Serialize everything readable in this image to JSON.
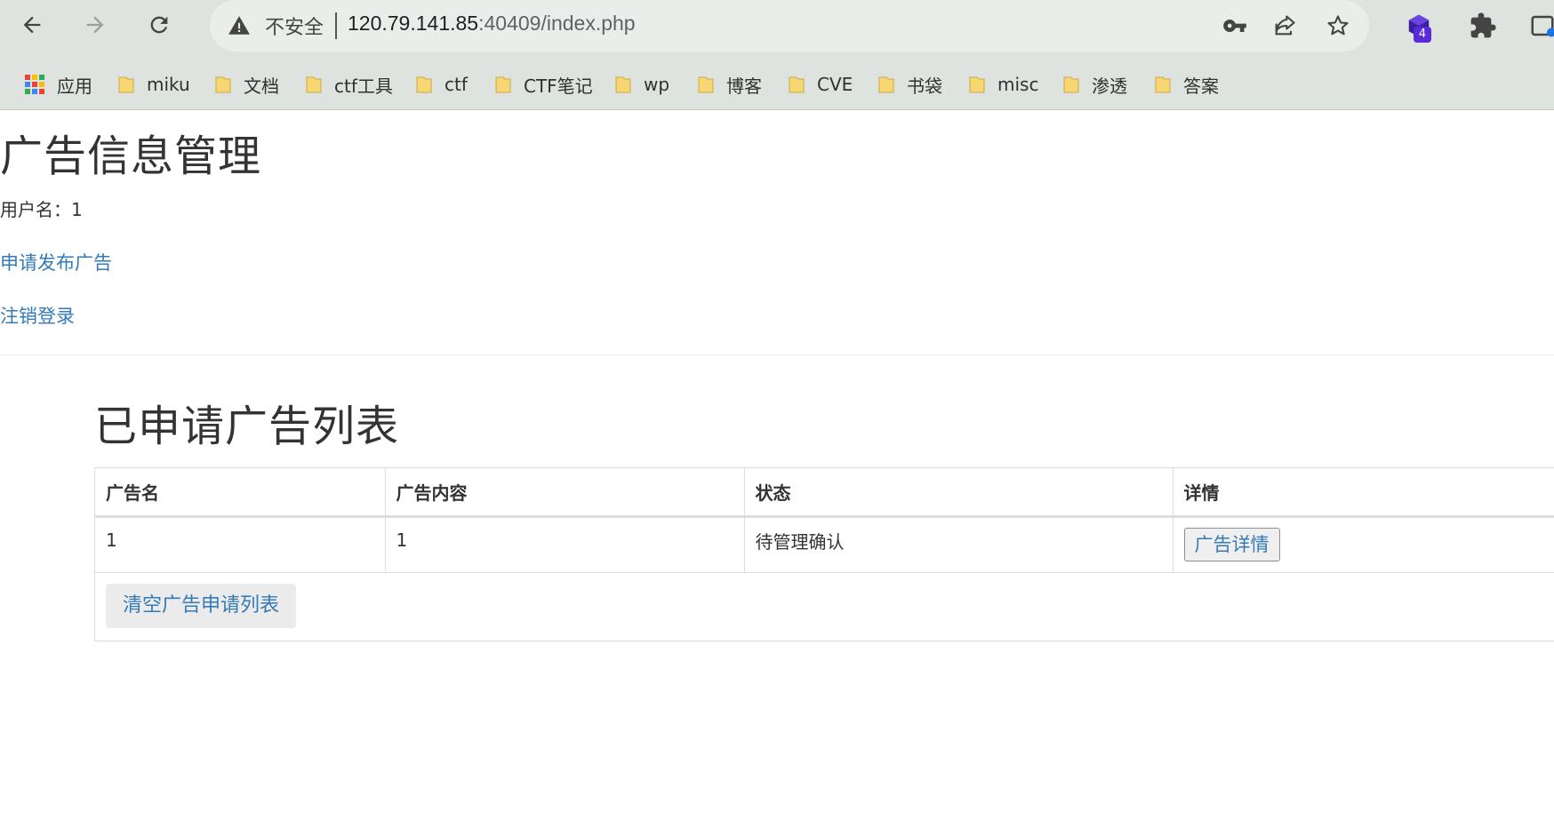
{
  "browser": {
    "security_label": "不安全",
    "url_host": "120.79.141.85",
    "url_rest": ":40409/index.php",
    "extension_badge": "4"
  },
  "bookmarks": [
    {
      "label": "应用",
      "icon": "apps-grid-icon"
    },
    {
      "label": "miku",
      "icon": "folder-icon"
    },
    {
      "label": "文档",
      "icon": "folder-icon"
    },
    {
      "label": "ctf工具",
      "icon": "folder-icon"
    },
    {
      "label": "ctf",
      "icon": "folder-icon"
    },
    {
      "label": "CTF笔记",
      "icon": "folder-icon"
    },
    {
      "label": "wp",
      "icon": "folder-icon"
    },
    {
      "label": "博客",
      "icon": "folder-icon"
    },
    {
      "label": "CVE",
      "icon": "folder-icon"
    },
    {
      "label": "书袋",
      "icon": "folder-icon"
    },
    {
      "label": "misc",
      "icon": "folder-icon"
    },
    {
      "label": "渗透",
      "icon": "folder-icon"
    },
    {
      "label": "答案",
      "icon": "folder-icon"
    }
  ],
  "page": {
    "title": "广告信息管理",
    "username_line": "用户名：1",
    "apply_link": "申请发布广告",
    "logout_link": "注销登录",
    "list_title": "已申请广告列表"
  },
  "table": {
    "headers": [
      "广告名",
      "广告内容",
      "状态",
      "详情"
    ],
    "rows": [
      {
        "name": "1",
        "content": "1",
        "status": "待管理确认",
        "detail_button": "广告详情"
      }
    ],
    "clear_button": "清空广告申请列表"
  },
  "colors": {
    "link": "#337ab7",
    "chrome_bg": "#dee3df",
    "folder": "#f7d774",
    "badge": "#5b2ad8"
  }
}
